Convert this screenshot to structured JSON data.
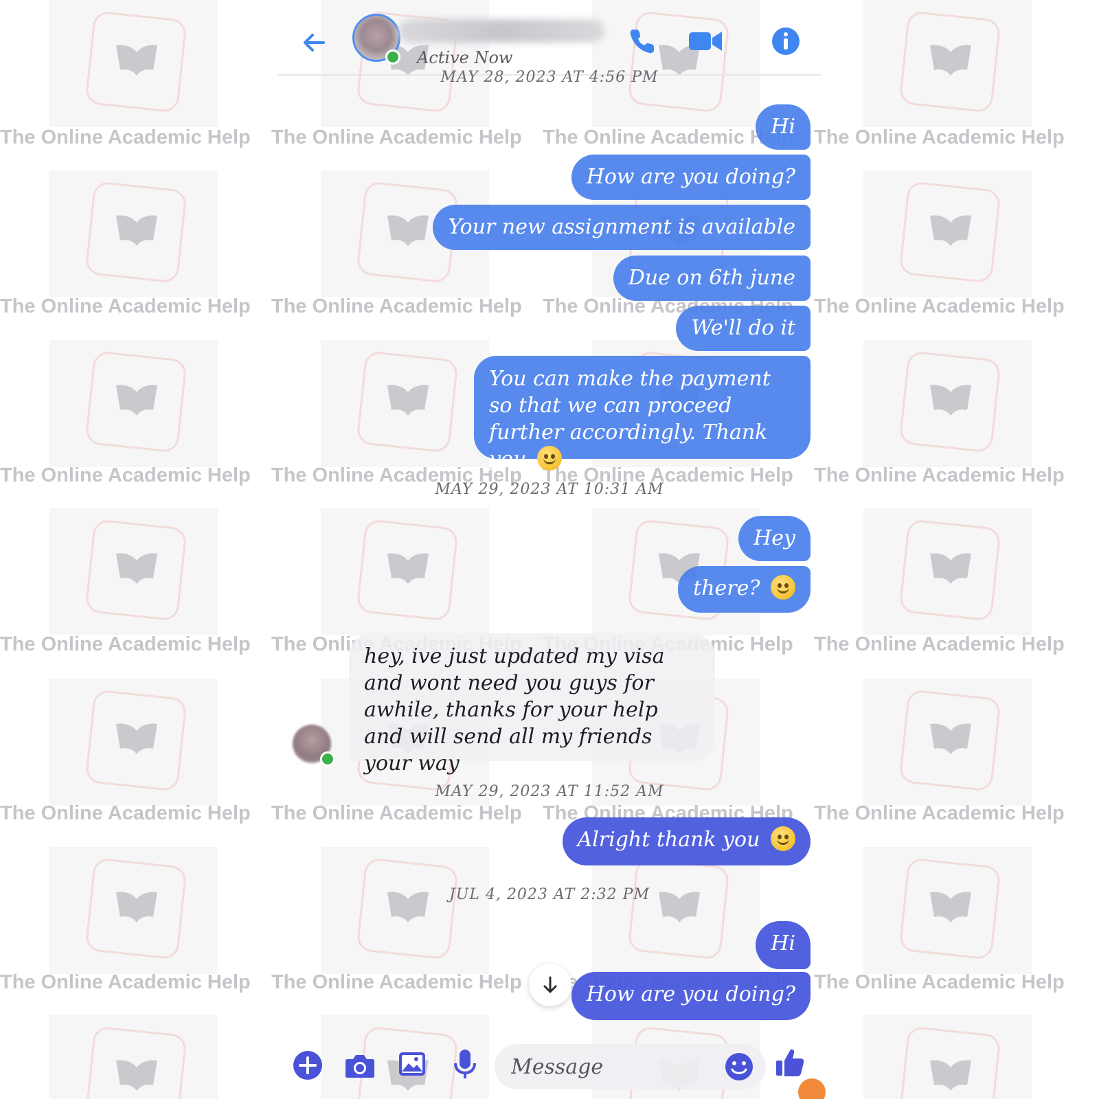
{
  "header": {
    "presence": "Active Now",
    "colors": {
      "accent": "#4f8ff0",
      "online": "#3bb04a"
    },
    "icons": [
      "back-arrow-icon",
      "phone-icon",
      "video-camera-icon",
      "info-icon"
    ]
  },
  "watermark": {
    "text": "The Online Academic Help"
  },
  "conversation": {
    "groups": [
      {
        "timestamp": "MAY 28, 2023 AT 4:56 PM",
        "messages": [
          {
            "from": "me",
            "text": "Hi"
          },
          {
            "from": "me",
            "text": "How are you doing?"
          },
          {
            "from": "me",
            "text": "Your new assignment is available"
          },
          {
            "from": "me",
            "text": "Due on 6th june"
          },
          {
            "from": "me",
            "text": "We'll do it"
          },
          {
            "from": "me",
            "text": "You can make the payment so that we can proceed further accordingly. Thank you",
            "emoji": "smiling-face-emoji"
          }
        ]
      },
      {
        "timestamp": "MAY 29, 2023 AT 10:31 AM",
        "messages": [
          {
            "from": "me",
            "text": "Hey"
          },
          {
            "from": "me",
            "text": "there?",
            "emoji": "slightly-smiling-face-emoji"
          },
          {
            "from": "contact",
            "text": "hey, ive just updated my visa and wont need you guys for awhile, thanks for your help and will send all my friends your way"
          }
        ]
      },
      {
        "timestamp": "MAY 29, 2023 AT 11:52 AM",
        "messages": [
          {
            "from": "me",
            "text": "Alright thank you",
            "emoji": "smiling-face-emoji"
          }
        ]
      },
      {
        "timestamp": "JUL 4, 2023 AT 2:32 PM",
        "messages": [
          {
            "from": "me",
            "text": "Hi"
          },
          {
            "from": "me",
            "text": "How are you doing?"
          }
        ]
      }
    ]
  },
  "composer": {
    "placeholder": "Message",
    "icons": [
      "plus-icon",
      "camera-icon",
      "gallery-icon",
      "microphone-icon",
      "emoji-icon",
      "thumbs-up-icon"
    ]
  }
}
